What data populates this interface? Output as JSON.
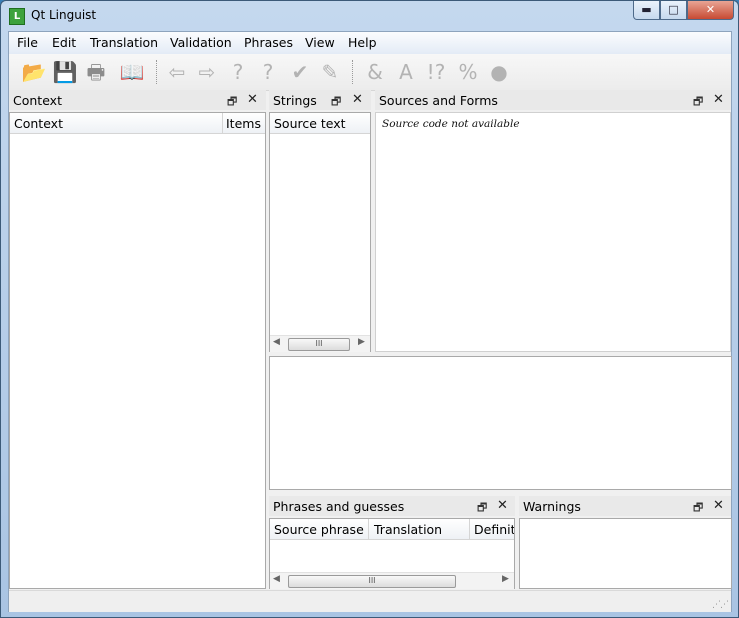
{
  "window": {
    "title": "Qt Linguist",
    "app_icon_letter": "L"
  },
  "caption_buttons": {
    "minimize": "▬",
    "maximize": "□",
    "close": "✕"
  },
  "menu": [
    "File",
    "Edit",
    "Translation",
    "Validation",
    "Phrases",
    "View",
    "Help"
  ],
  "toolbar": {
    "icons": [
      "open-icon",
      "save-icon",
      "print-icon",
      "phrasebook-icon",
      "prev-icon",
      "next-icon",
      "prev-unfinished-icon",
      "next-unfinished-icon",
      "done-next-icon",
      "done-icon",
      "accelerators-icon",
      "ending-punctuation-icon",
      "phrase-match-icon",
      "place-marker-icon",
      "surrounding-whitespace-icon"
    ]
  },
  "docks": {
    "context": {
      "title": "Context",
      "columns": [
        "Context",
        "Items"
      ]
    },
    "strings": {
      "title": "Strings",
      "columns": [
        "Source text"
      ]
    },
    "sources": {
      "title": "Sources and Forms",
      "message": "Source code not available"
    },
    "phrases": {
      "title": "Phrases and guesses",
      "columns": [
        "Source phrase",
        "Translation",
        "Definiti"
      ]
    },
    "warnings": {
      "title": "Warnings"
    }
  },
  "dock_controls": {
    "float": "🗗",
    "close": "✕"
  },
  "scroll_glyphs": {
    "left": "◀",
    "right": "▶",
    "grip": "III"
  },
  "colors": {
    "titlebar": "#b9d1ea",
    "panel_header": "#e9e9e9",
    "close_button": "#c74a33"
  }
}
